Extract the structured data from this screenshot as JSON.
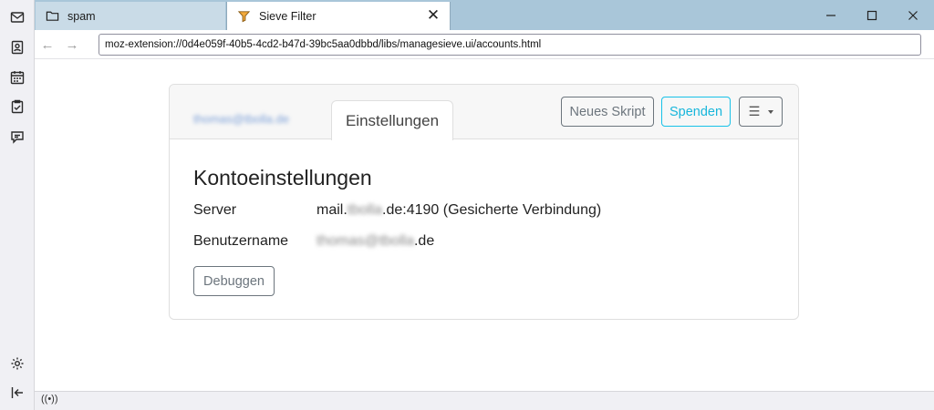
{
  "spaces": {
    "icons": [
      "mail-icon",
      "address-book-icon",
      "calendar-icon",
      "tasks-icon",
      "chat-icon",
      "settings-icon",
      "collapse-icon"
    ]
  },
  "tabs": [
    {
      "label": "spam",
      "icon": "folder-icon",
      "active": false
    },
    {
      "label": "Sieve Filter",
      "icon": "sieve-funnel-icon",
      "active": true,
      "close": "✕"
    }
  ],
  "window": {
    "minimize": "minimize-icon",
    "maximize": "maximize-icon",
    "close": "close-icon"
  },
  "nav": {
    "back": "←",
    "forward": "→",
    "url": "moz-extension://0d4e059f-40b5-4cd2-b47d-39bc5aa0dbbd/libs/managesieve.ui/accounts.html"
  },
  "card": {
    "account_tab": "thomas@tbolla.de",
    "settings_tab": "Einstellungen",
    "new_script_button": "Neues Skript",
    "donate_button": "Spenden",
    "menu_button": "☰",
    "title": "Kontoeinstellungen",
    "server_label": "Server",
    "server_prefix": "mail.",
    "server_blurred": "tbolla",
    "server_suffix": ".de:4190 (Gesicherte Verbindung)",
    "username_label": "Benutzername",
    "username_blurred": "thomas@tbolla",
    "username_suffix": ".de",
    "debug_button": "Debuggen"
  },
  "colors": {
    "accent": "#17c1e8",
    "tabstrip": "#a9c6d9"
  },
  "status": {
    "icon": "((•))"
  }
}
